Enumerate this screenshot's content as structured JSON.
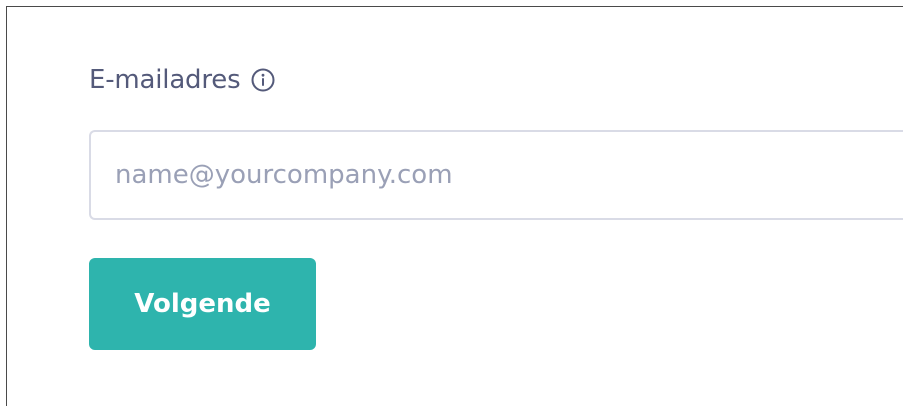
{
  "form": {
    "email_label": "E-mailadres",
    "email_info_icon": "info-circle-icon",
    "email_value": "",
    "email_placeholder": "name@yourcompany.com",
    "next_label": "Volgende"
  },
  "colors": {
    "accent": "#2eb4ad",
    "label_text": "#545a7a",
    "placeholder": "#9aa0b6",
    "input_border": "#d9dbe6"
  }
}
